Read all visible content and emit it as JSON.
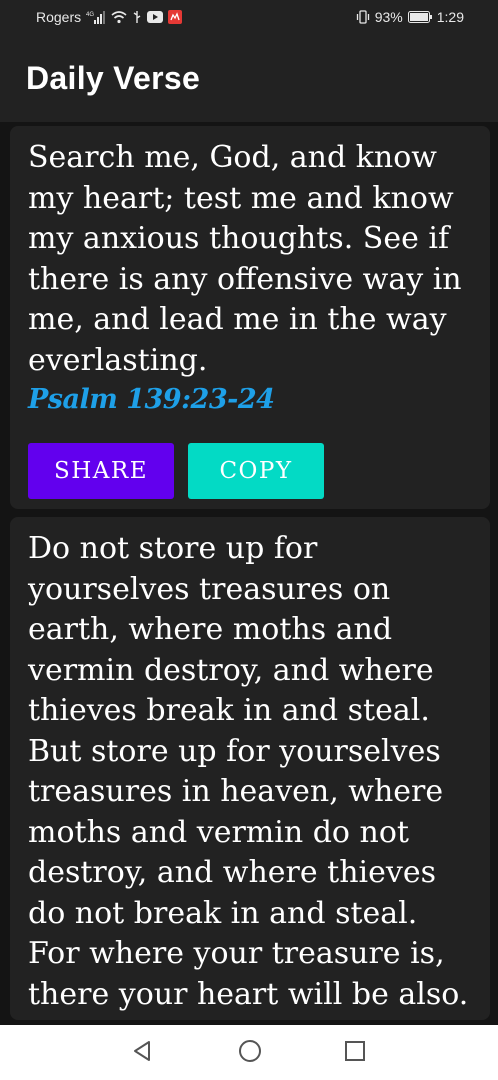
{
  "status_bar": {
    "carrier": "Rogers",
    "battery": "93%",
    "time": "1:29"
  },
  "app_bar": {
    "title": "Daily Verse"
  },
  "verses": [
    {
      "text": "Search me, God, and know my heart; test me and know my anxious thoughts. See if there is any offensive way in me, and lead me in the way everlasting.",
      "reference": "Psalm 139:23-24",
      "share_label": "SHARE",
      "copy_label": "COPY"
    },
    {
      "text": "Do not store up for yourselves treasures on earth, where moths and vermin destroy, and where thieves break in and steal. But store up for yourselves treasures in heaven, where moths and vermin do not destroy, and where thieves do not break in and steal. For where your treasure is, there your heart will be also."
    }
  ],
  "colors": {
    "share_button": "#6200ee",
    "copy_button": "#03dac5",
    "reference": "#1ea0e8",
    "card_background": "#222222"
  },
  "icons": {
    "status": [
      "signal-icon",
      "wifi-icon",
      "usb-icon",
      "youtube-icon",
      "notification-icon",
      "vibrate-icon",
      "battery-icon"
    ],
    "nav": [
      "back-icon",
      "home-icon",
      "recents-icon"
    ]
  }
}
